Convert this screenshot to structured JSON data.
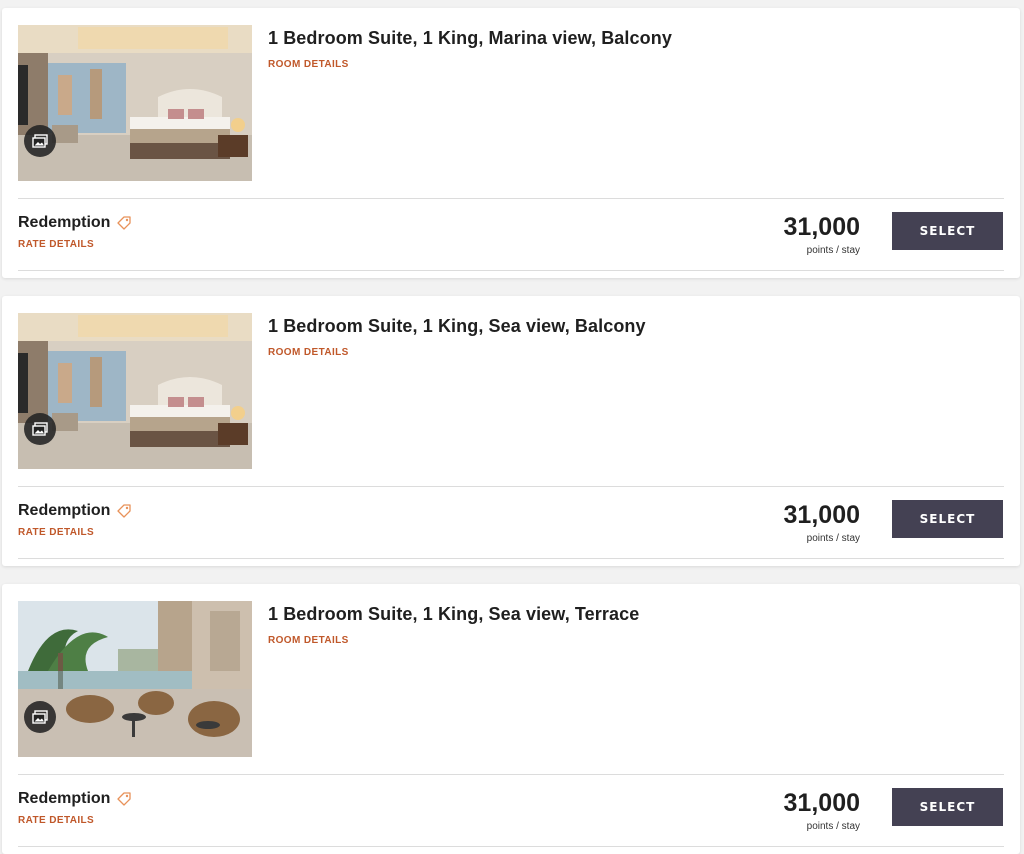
{
  "rooms": [
    {
      "title": "1 Bedroom Suite, 1 King, Marina view, Balcony",
      "room_details_label": "ROOM DETAILS",
      "image_type": "bedroom",
      "rate_name": "Redemption",
      "rate_details_label": "RATE DETAILS",
      "points": "31,000",
      "points_unit": "points / stay",
      "select_label": "SELECT"
    },
    {
      "title": "1 Bedroom Suite, 1 King, Sea view, Balcony",
      "room_details_label": "ROOM DETAILS",
      "image_type": "bedroom",
      "rate_name": "Redemption",
      "rate_details_label": "RATE DETAILS",
      "points": "31,000",
      "points_unit": "points / stay",
      "select_label": "SELECT"
    },
    {
      "title": "1 Bedroom Suite, 1 King, Sea view, Terrace",
      "room_details_label": "ROOM DETAILS",
      "image_type": "terrace",
      "rate_name": "Redemption",
      "rate_details_label": "RATE DETAILS",
      "points": "31,000",
      "points_unit": "points / stay",
      "select_label": "SELECT"
    }
  ],
  "icons": {
    "gallery": "gallery-icon",
    "rate_tag": "tag-icon"
  },
  "colors": {
    "accent_link": "#c0582a",
    "button_bg": "#444153",
    "tag_icon": "#e8925a"
  }
}
